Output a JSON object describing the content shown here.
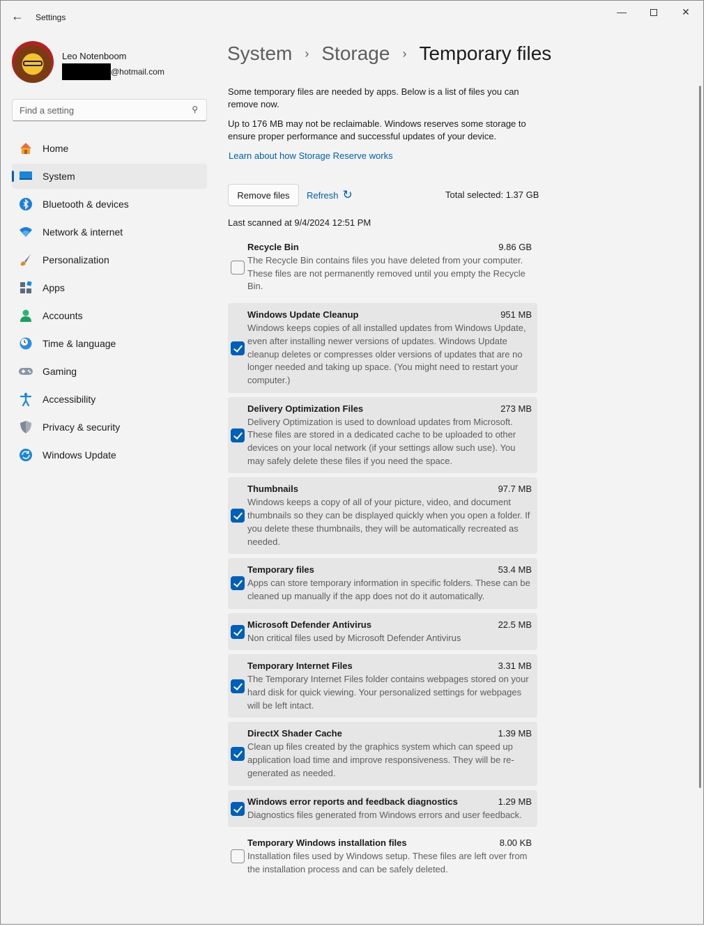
{
  "window": {
    "title": "Settings",
    "minimize": "—",
    "close": "✕"
  },
  "user": {
    "name": "Leo Notenboom",
    "email_suffix": "@hotmail.com"
  },
  "search": {
    "placeholder": "Find a setting"
  },
  "nav": [
    {
      "label": "Home",
      "icon": "home-icon",
      "active": false
    },
    {
      "label": "System",
      "icon": "system-icon",
      "active": true
    },
    {
      "label": "Bluetooth & devices",
      "icon": "bluetooth-icon",
      "active": false
    },
    {
      "label": "Network & internet",
      "icon": "wifi-icon",
      "active": false
    },
    {
      "label": "Personalization",
      "icon": "brush-icon",
      "active": false
    },
    {
      "label": "Apps",
      "icon": "apps-icon",
      "active": false
    },
    {
      "label": "Accounts",
      "icon": "accounts-icon",
      "active": false
    },
    {
      "label": "Time & language",
      "icon": "clock-globe-icon",
      "active": false
    },
    {
      "label": "Gaming",
      "icon": "gamepad-icon",
      "active": false
    },
    {
      "label": "Accessibility",
      "icon": "accessibility-icon",
      "active": false
    },
    {
      "label": "Privacy & security",
      "icon": "shield-icon",
      "active": false
    },
    {
      "label": "Windows Update",
      "icon": "update-icon",
      "active": false
    }
  ],
  "breadcrumb": {
    "part1": "System",
    "part2": "Storage",
    "current": "Temporary files",
    "separator": "›"
  },
  "intro": {
    "line1": "Some temporary files are needed by apps. Below is a list of files you can remove now.",
    "line2": "Up to 176 MB may not be reclaimable. Windows reserves some storage to ensure proper performance and successful updates of your device.",
    "link": "Learn about how Storage Reserve works"
  },
  "actions": {
    "remove_label": "Remove files",
    "refresh_label": "Refresh",
    "total_selected": "Total selected: 1.37 GB"
  },
  "last_scanned": "Last scanned at 9/4/2024 12:51 PM",
  "files": [
    {
      "name": "Recycle Bin",
      "size": "9.86 GB",
      "checked": false,
      "desc": "The Recycle Bin contains files you have deleted from your computer. These files are not permanently removed until you empty the Recycle Bin."
    },
    {
      "name": "Windows Update Cleanup",
      "size": "951 MB",
      "checked": true,
      "desc": "Windows keeps copies of all installed updates from Windows Update, even after installing newer versions of updates. Windows Update cleanup deletes or compresses older versions of updates that are no longer needed and taking up space. (You might need to restart your computer.)"
    },
    {
      "name": "Delivery Optimization Files",
      "size": "273 MB",
      "checked": true,
      "desc": "Delivery Optimization is used to download updates from Microsoft. These files are stored in a dedicated cache to be uploaded to other devices on your local network (if your settings allow such use). You may safely delete these files if you need the space."
    },
    {
      "name": "Thumbnails",
      "size": "97.7 MB",
      "checked": true,
      "desc": "Windows keeps a copy of all of your picture, video, and document thumbnails so they can be displayed quickly when you open a folder. If you delete these thumbnails, they will be automatically recreated as needed."
    },
    {
      "name": "Temporary files",
      "size": "53.4 MB",
      "checked": true,
      "desc": "Apps can store temporary information in specific folders. These can be cleaned up manually if the app does not do it automatically."
    },
    {
      "name": "Microsoft Defender Antivirus",
      "size": "22.5 MB",
      "checked": true,
      "desc": "Non critical files used by Microsoft Defender Antivirus"
    },
    {
      "name": "Temporary Internet Files",
      "size": "3.31 MB",
      "checked": true,
      "desc": "The Temporary Internet Files folder contains webpages stored on your hard disk for quick viewing. Your personalized settings for webpages will be left intact."
    },
    {
      "name": "DirectX Shader Cache",
      "size": "1.39 MB",
      "checked": true,
      "desc": "Clean up files created by the graphics system which can speed up application load time and improve responsiveness. They will be re-generated as needed."
    },
    {
      "name": "Windows error reports and feedback diagnostics",
      "size": "1.29 MB",
      "checked": true,
      "desc": "Diagnostics files generated from Windows errors and user feedback."
    },
    {
      "name": "Temporary Windows installation files",
      "size": "8.00 KB",
      "checked": false,
      "desc": "Installation files used by Windows setup.  These files are left over from the installation process and can be safely deleted."
    }
  ],
  "colors": {
    "accent": "#005fb8",
    "window_bg": "#f3f3f3",
    "card_bg": "#e6e6e6"
  }
}
